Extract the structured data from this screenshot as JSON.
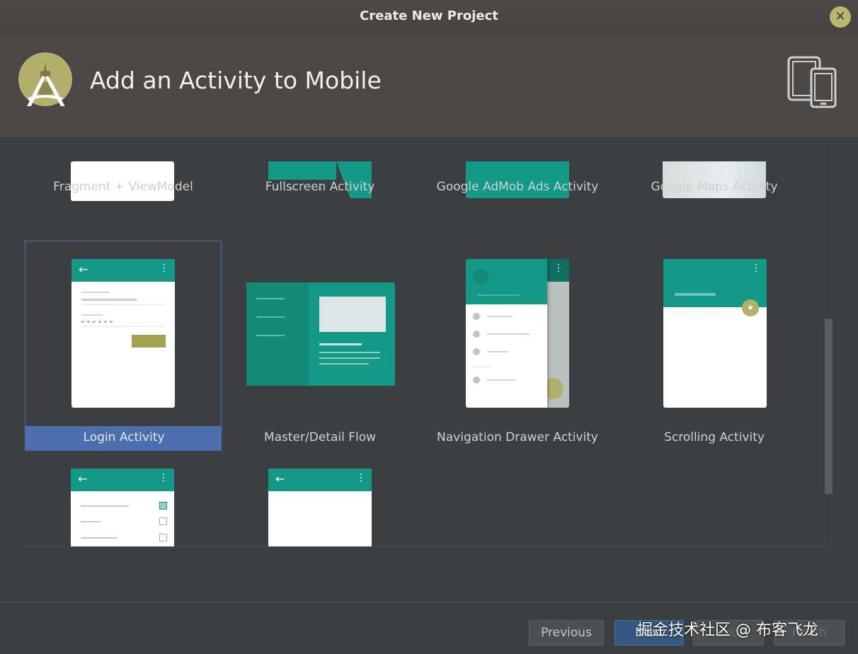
{
  "window": {
    "title": "Create New Project"
  },
  "header": {
    "title": "Add an Activity to Mobile"
  },
  "tiles_row1": [
    {
      "label": "Fragment + ViewModel"
    },
    {
      "label": "Fullscreen Activity"
    },
    {
      "label": "Google AdMob Ads Activity"
    },
    {
      "label": "Google Maps Activity"
    }
  ],
  "tiles_row2": [
    {
      "label": "Login Activity"
    },
    {
      "label": "Master/Detail Flow"
    },
    {
      "label": "Navigation Drawer Activity"
    },
    {
      "label": "Scrolling Activity"
    }
  ],
  "buttons": {
    "previous": "Previous",
    "next": "Next",
    "cancel": "Cancel",
    "finish": "Finish"
  },
  "watermark": "掘金技术社区 @ 布客飞龙",
  "colors": {
    "accent": "#139986",
    "selection": "#4b6eaf",
    "fab": "#b2b06c"
  }
}
